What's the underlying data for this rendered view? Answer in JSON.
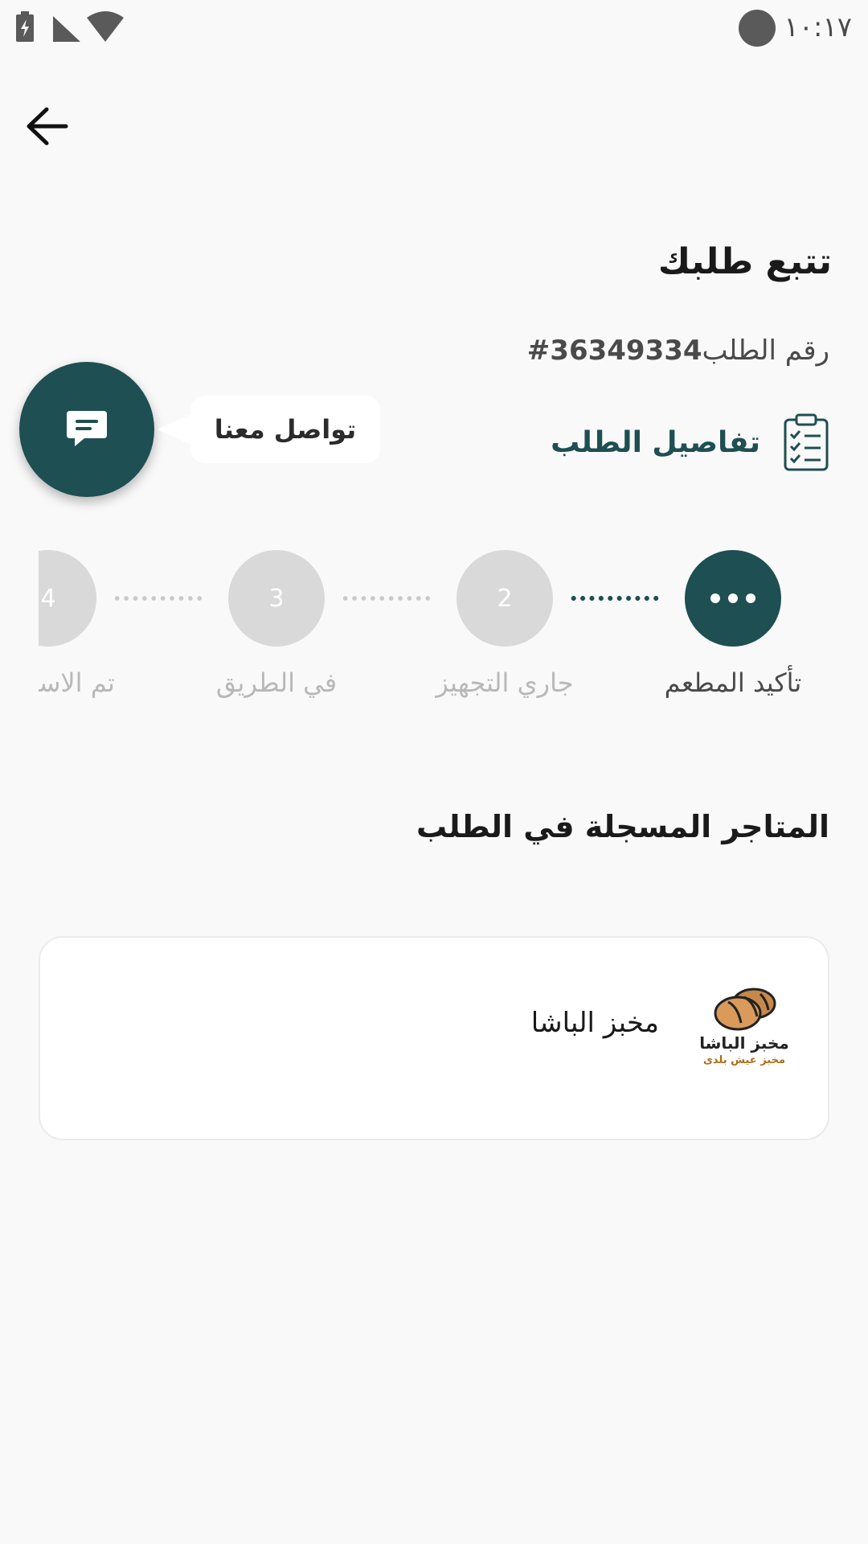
{
  "status_bar": {
    "time": "١٠:١٧"
  },
  "header": {
    "back_icon": "arrow-left-icon"
  },
  "page": {
    "title": "تتبع طلبك",
    "order_number_label": "رقم الطلب",
    "order_number_value": "#36349334",
    "details_label": "تفاصيل الطلب",
    "details_icon": "clipboard-checklist-icon"
  },
  "chat": {
    "label": "تواصل معنا",
    "icon": "chat-bubble-icon"
  },
  "stepper": {
    "steps": [
      {
        "number": "",
        "label": "تأكيد المطعم",
        "active": true,
        "icon": "more-dots-icon"
      },
      {
        "number": "2",
        "label": "جاري التجهيز",
        "active": false
      },
      {
        "number": "3",
        "label": "في الطريق",
        "active": false
      },
      {
        "number": "4",
        "label": "تم الاستلام",
        "active": false
      }
    ]
  },
  "stores": {
    "section_title": "المتاجر المسجلة في الطلب",
    "items": [
      {
        "name": "مخبز الباشا",
        "logo_title": "مخبز الباشا",
        "logo_subtitle": "مخبز عيش بلدى"
      }
    ]
  },
  "colors": {
    "primary": "#1e4f52",
    "background": "#f9f9f9",
    "inactive": "#d9d9d9"
  }
}
